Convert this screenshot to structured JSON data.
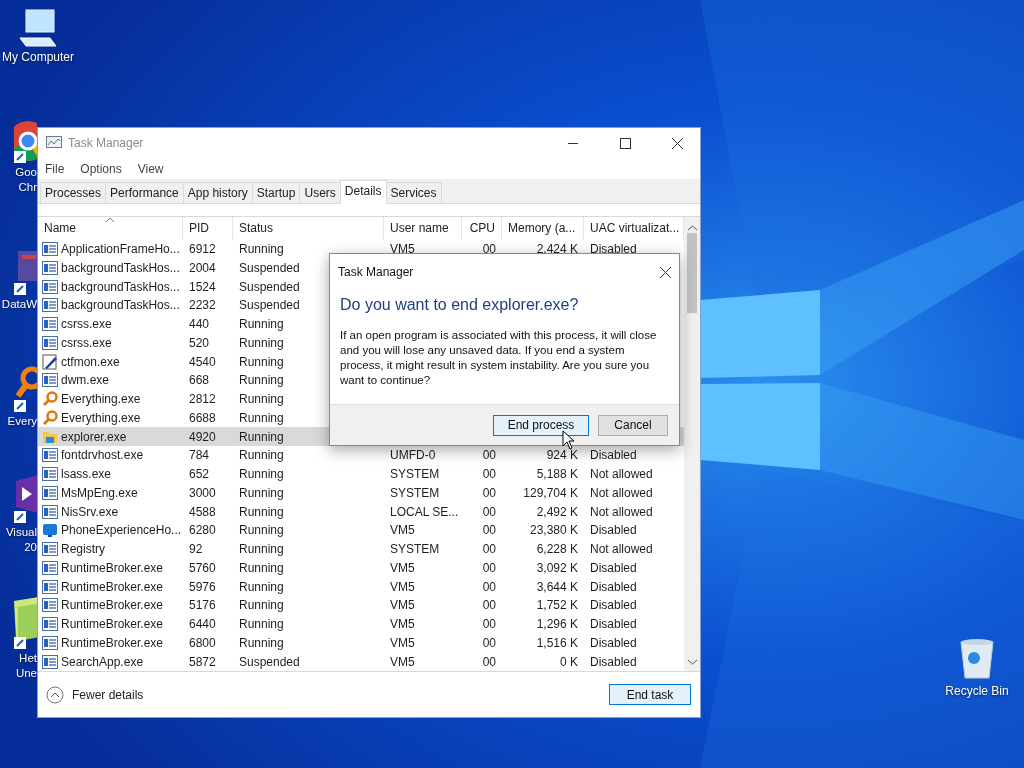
{
  "desktop": {
    "icons": [
      {
        "kind": "computer",
        "lines": [
          "My Computer"
        ]
      },
      {
        "kind": "chrome",
        "lines": [
          "Goo",
          "Chr"
        ]
      },
      {
        "kind": "data",
        "lines": [
          "DataW"
        ]
      },
      {
        "kind": "key",
        "lines": [
          "Every"
        ]
      },
      {
        "kind": "studio",
        "lines": [
          "Visual",
          "20"
        ]
      },
      {
        "kind": "folder",
        "lines": [
          "Het",
          "Une"
        ]
      }
    ],
    "recycle_bin": {
      "label": "Recycle Bin"
    }
  },
  "window": {
    "title": "Task Manager",
    "menu": [
      "File",
      "Options",
      "View"
    ],
    "tabs": [
      {
        "label": "Processes",
        "selected": false
      },
      {
        "label": "Performance",
        "selected": false
      },
      {
        "label": "App history",
        "selected": false
      },
      {
        "label": "Startup",
        "selected": false
      },
      {
        "label": "Users",
        "selected": false
      },
      {
        "label": "Details",
        "selected": true
      },
      {
        "label": "Services",
        "selected": false
      }
    ],
    "table": {
      "columns": [
        "Name",
        "PID",
        "Status",
        "User name",
        "CPU",
        "Memory (a...",
        "UAC virtualizat..."
      ],
      "rows": [
        {
          "kind": "generic",
          "selected": false,
          "cells": [
            "ApplicationFrameHo...",
            "6912",
            "Running",
            "VM5",
            "00",
            "2,424 K",
            "Disabled"
          ]
        },
        {
          "kind": "generic",
          "selected": false,
          "cells": [
            "backgroundTaskHos...",
            "2004",
            "Suspended"
          ]
        },
        {
          "kind": "generic",
          "selected": false,
          "cells": [
            "backgroundTaskHos...",
            "1524",
            "Suspended"
          ]
        },
        {
          "kind": "generic",
          "selected": false,
          "cells": [
            "backgroundTaskHos...",
            "2232",
            "Suspended"
          ]
        },
        {
          "kind": "generic",
          "selected": false,
          "cells": [
            "csrss.exe",
            "440",
            "Running"
          ]
        },
        {
          "kind": "generic",
          "selected": false,
          "cells": [
            "csrss.exe",
            "520",
            "Running"
          ]
        },
        {
          "kind": "pen",
          "selected": false,
          "cells": [
            "ctfmon.exe",
            "4540",
            "Running"
          ]
        },
        {
          "kind": "generic",
          "selected": false,
          "cells": [
            "dwm.exe",
            "668",
            "Running"
          ]
        },
        {
          "kind": "key",
          "selected": false,
          "cells": [
            "Everything.exe",
            "2812",
            "Running"
          ]
        },
        {
          "kind": "key",
          "selected": false,
          "cells": [
            "Everything.exe",
            "6688",
            "Running"
          ]
        },
        {
          "kind": "folder",
          "selected": true,
          "cells": [
            "explorer.exe",
            "4920",
            "Running"
          ]
        },
        {
          "kind": "generic",
          "selected": false,
          "cells": [
            "fontdrvhost.exe",
            "784",
            "Running",
            "UMFD-0",
            "00",
            "924 K",
            "Disabled"
          ]
        },
        {
          "kind": "generic",
          "selected": false,
          "cells": [
            "lsass.exe",
            "652",
            "Running",
            "SYSTEM",
            "00",
            "5,188 K",
            "Not allowed"
          ]
        },
        {
          "kind": "generic",
          "selected": false,
          "cells": [
            "MsMpEng.exe",
            "3000",
            "Running",
            "SYSTEM",
            "00",
            "129,704 K",
            "Not allowed"
          ]
        },
        {
          "kind": "generic",
          "selected": false,
          "cells": [
            "NisSrv.exe",
            "4588",
            "Running",
            "LOCAL SE...",
            "00",
            "2,492 K",
            "Not allowed"
          ]
        },
        {
          "kind": "phone",
          "selected": false,
          "cells": [
            "PhoneExperienceHo...",
            "6280",
            "Running",
            "VM5",
            "00",
            "23,380 K",
            "Disabled"
          ]
        },
        {
          "kind": "generic",
          "selected": false,
          "cells": [
            "Registry",
            "92",
            "Running",
            "SYSTEM",
            "00",
            "6,228 K",
            "Not allowed"
          ]
        },
        {
          "kind": "generic",
          "selected": false,
          "cells": [
            "RuntimeBroker.exe",
            "5760",
            "Running",
            "VM5",
            "00",
            "3,092 K",
            "Disabled"
          ]
        },
        {
          "kind": "generic",
          "selected": false,
          "cells": [
            "RuntimeBroker.exe",
            "5976",
            "Running",
            "VM5",
            "00",
            "3,644 K",
            "Disabled"
          ]
        },
        {
          "kind": "generic",
          "selected": false,
          "cells": [
            "RuntimeBroker.exe",
            "5176",
            "Running",
            "VM5",
            "00",
            "1,752 K",
            "Disabled"
          ]
        },
        {
          "kind": "generic",
          "selected": false,
          "cells": [
            "RuntimeBroker.exe",
            "6440",
            "Running",
            "VM5",
            "00",
            "1,296 K",
            "Disabled"
          ]
        },
        {
          "kind": "generic",
          "selected": false,
          "cells": [
            "RuntimeBroker.exe",
            "6800",
            "Running",
            "VM5",
            "00",
            "1,516 K",
            "Disabled"
          ]
        },
        {
          "kind": "generic",
          "selected": false,
          "cells": [
            "SearchApp.exe",
            "5872",
            "Suspended",
            "VM5",
            "00",
            "0 K",
            "Disabled"
          ]
        }
      ]
    },
    "footer": {
      "toggle": "Fewer details",
      "button": "End task"
    }
  },
  "dialog": {
    "title": "Task Manager",
    "heading": "Do you want to end explorer.exe?",
    "body": "If an open program is associated with this process, it will close and you will lose any unsaved data. If you end a system process, it might result in system instability. Are you sure you want to continue?",
    "buttons": [
      {
        "label": "End process",
        "selected": true
      },
      {
        "label": "Cancel",
        "selected": false
      }
    ]
  }
}
